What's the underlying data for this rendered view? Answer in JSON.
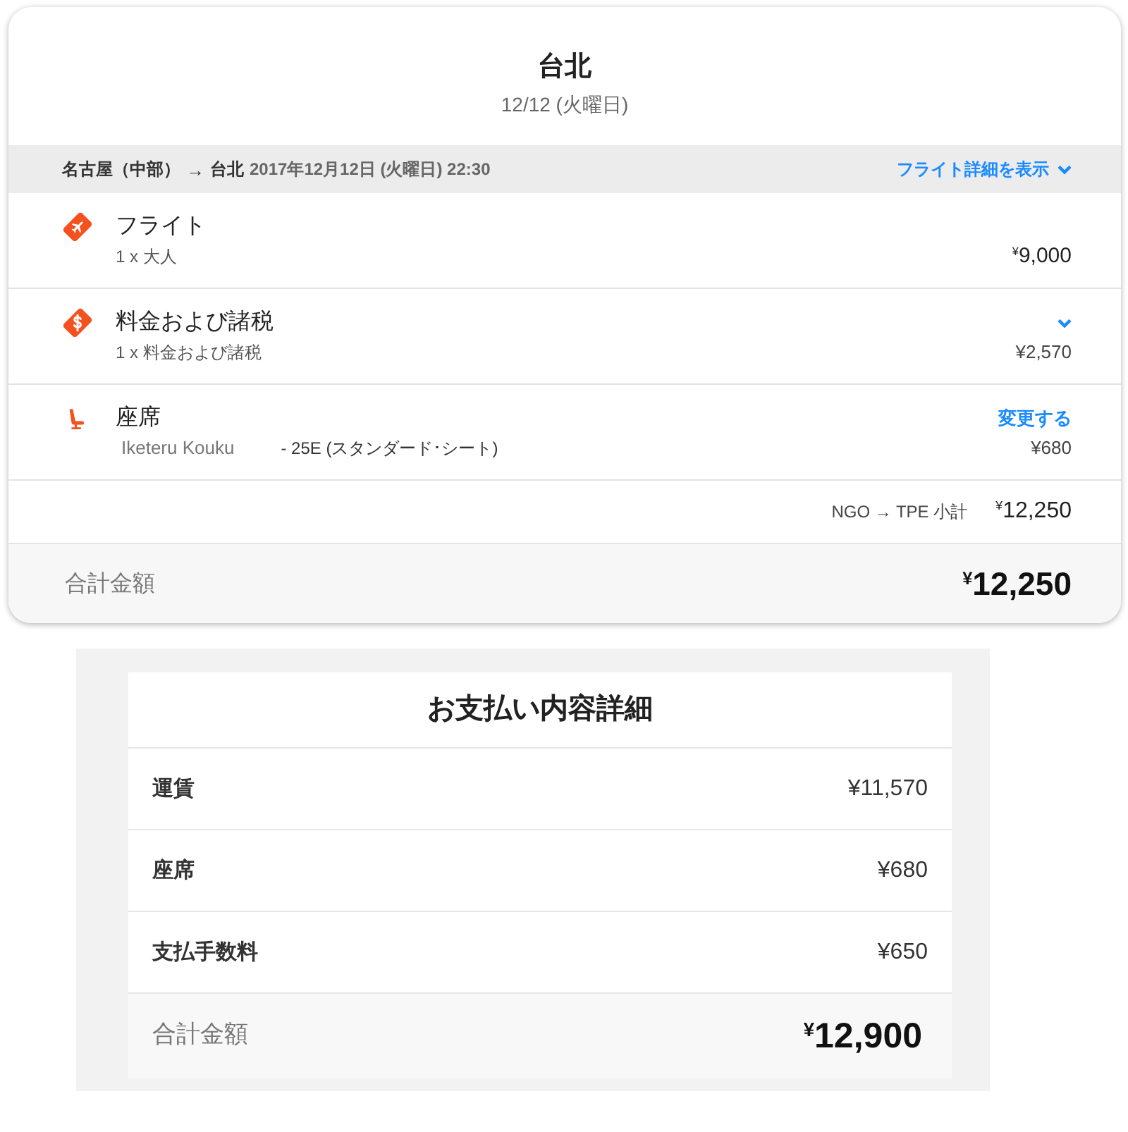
{
  "header": {
    "title": "台北",
    "date": "12/12 (火曜日)"
  },
  "route": {
    "origin": "名古屋（中部）",
    "arrow": "→",
    "destination": "台北",
    "departure": "2017年12月12日 (火曜日) 22:30",
    "details_link": "フライト詳細を表示"
  },
  "items": [
    {
      "kind": "flight",
      "title": "フライト",
      "detail": "1 x 大人",
      "price": "$^{¥}$9,000"
    },
    {
      "kind": "fees",
      "title": "料金および諸税",
      "detail": "1 x 料金および諸税",
      "price": "¥2,570"
    },
    {
      "kind": "seat",
      "title": "座席",
      "passenger": "Iketeru Kouku",
      "seat": "- 25E (スタンダード･シート)",
      "action": "変更する",
      "price": "¥680"
    }
  ],
  "subtotal": {
    "label": "NGO → TPE 小計",
    "amount": "$^{¥}$12,250"
  },
  "total": {
    "label": "合計金額",
    "amount": "$^{¥}$12,250"
  },
  "payment": {
    "title": "お支払い内容詳細",
    "rows": [
      {
        "label": "運賃",
        "amount": "¥11,570"
      },
      {
        "label": "座席",
        "amount": "¥680"
      },
      {
        "label": "支払手数料",
        "amount": "¥650"
      }
    ],
    "total": {
      "label": "合計金額",
      "amount": "$^{¥}$12,900"
    }
  }
}
